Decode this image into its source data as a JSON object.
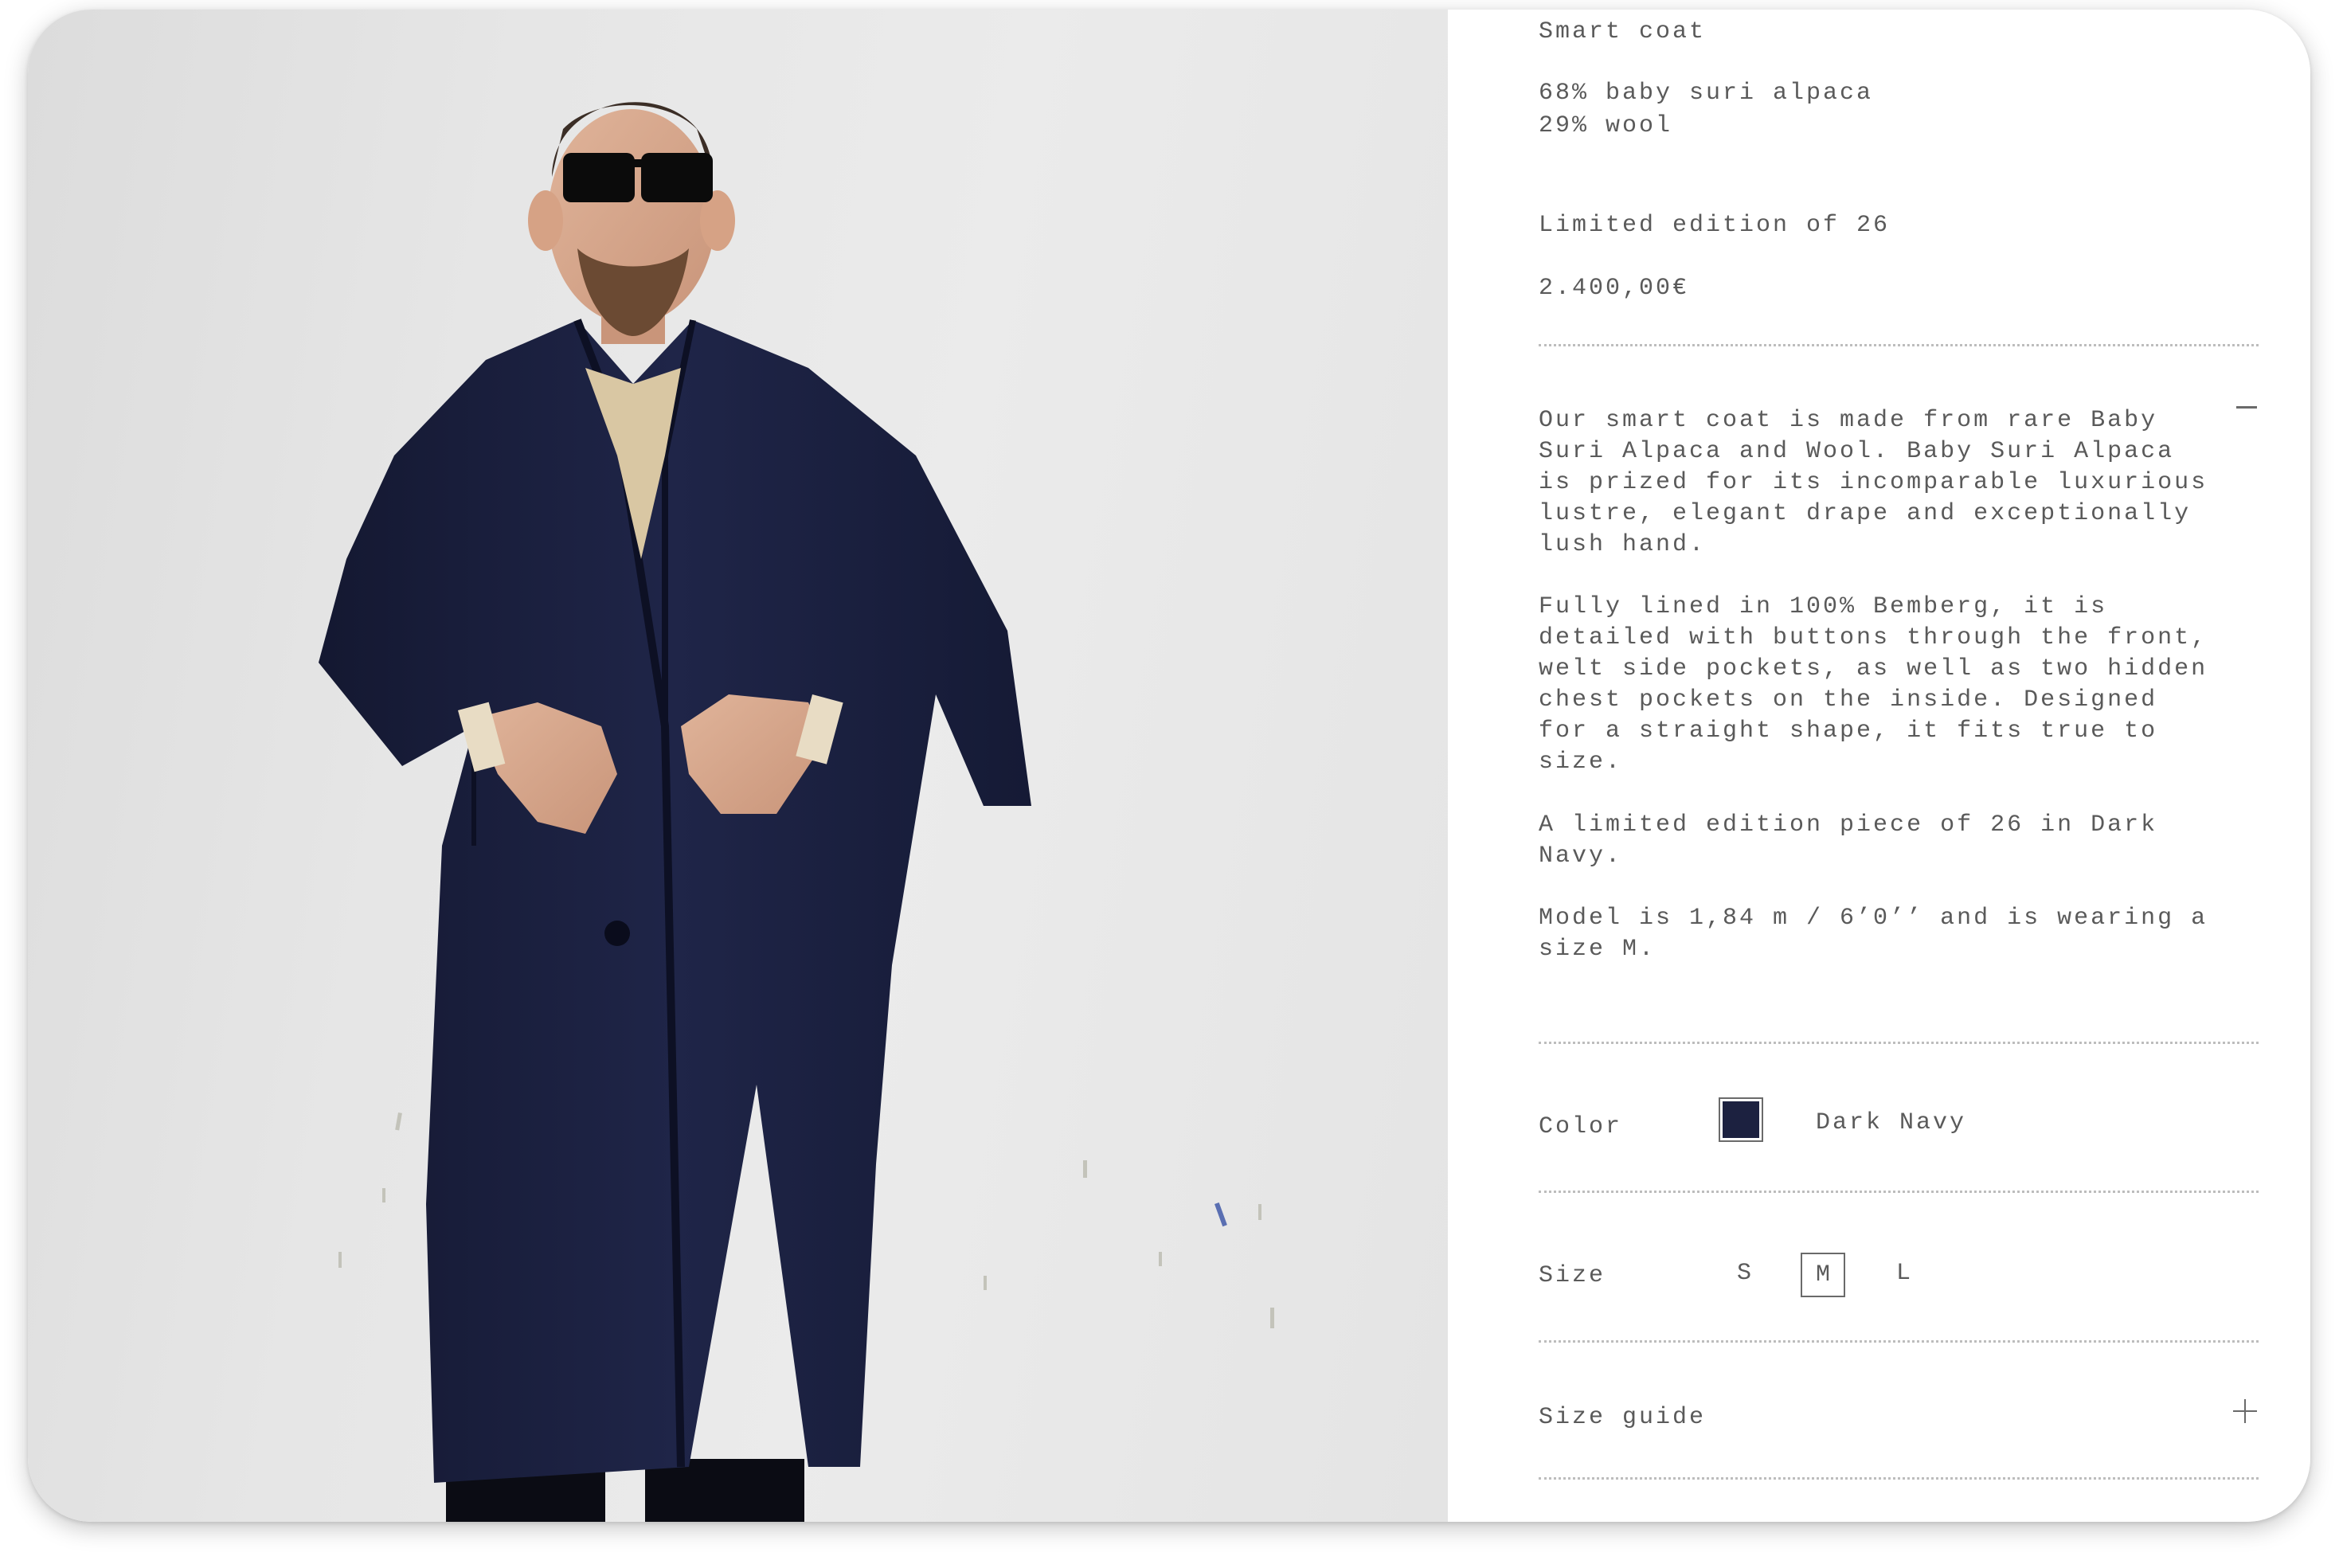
{
  "product": {
    "name": "Smart coat",
    "composition": [
      "68% baby suri alpaca",
      "29% wool"
    ],
    "edition": "Limited edition of 26",
    "price": "2.400,00€"
  },
  "description": {
    "paragraphs": [
      "Our smart coat is made from rare Baby Suri Alpaca and Wool. Baby Suri Alpaca is prized for its incomparable luxurious lustre, elegant drape and exceptionally lush hand.",
      "Fully lined in 100% Bemberg, it is detailed with buttons through the front, welt side pockets, as well as two hidden chest pockets on the inside. Designed for a straight shape, it fits true to size.",
      "A limited edition piece of 26 in Dark Navy.",
      "Model is 1,84 m / 6’0’’ and is wearing a size M."
    ],
    "toggle_icon": "minus-icon"
  },
  "color": {
    "label": "Color",
    "swatch_hex": "#1c2140",
    "selected_name": "Dark Navy"
  },
  "size": {
    "label": "Size",
    "options": [
      "S",
      "M",
      "L"
    ],
    "selected": "M"
  },
  "size_guide": {
    "label": "Size guide",
    "icon": "plus-icon"
  },
  "colors": {
    "text": "#5a5a5a",
    "divider": "#bdbdbd",
    "coat_navy": "#1c2140",
    "photo_background": "#e6e6e6"
  }
}
